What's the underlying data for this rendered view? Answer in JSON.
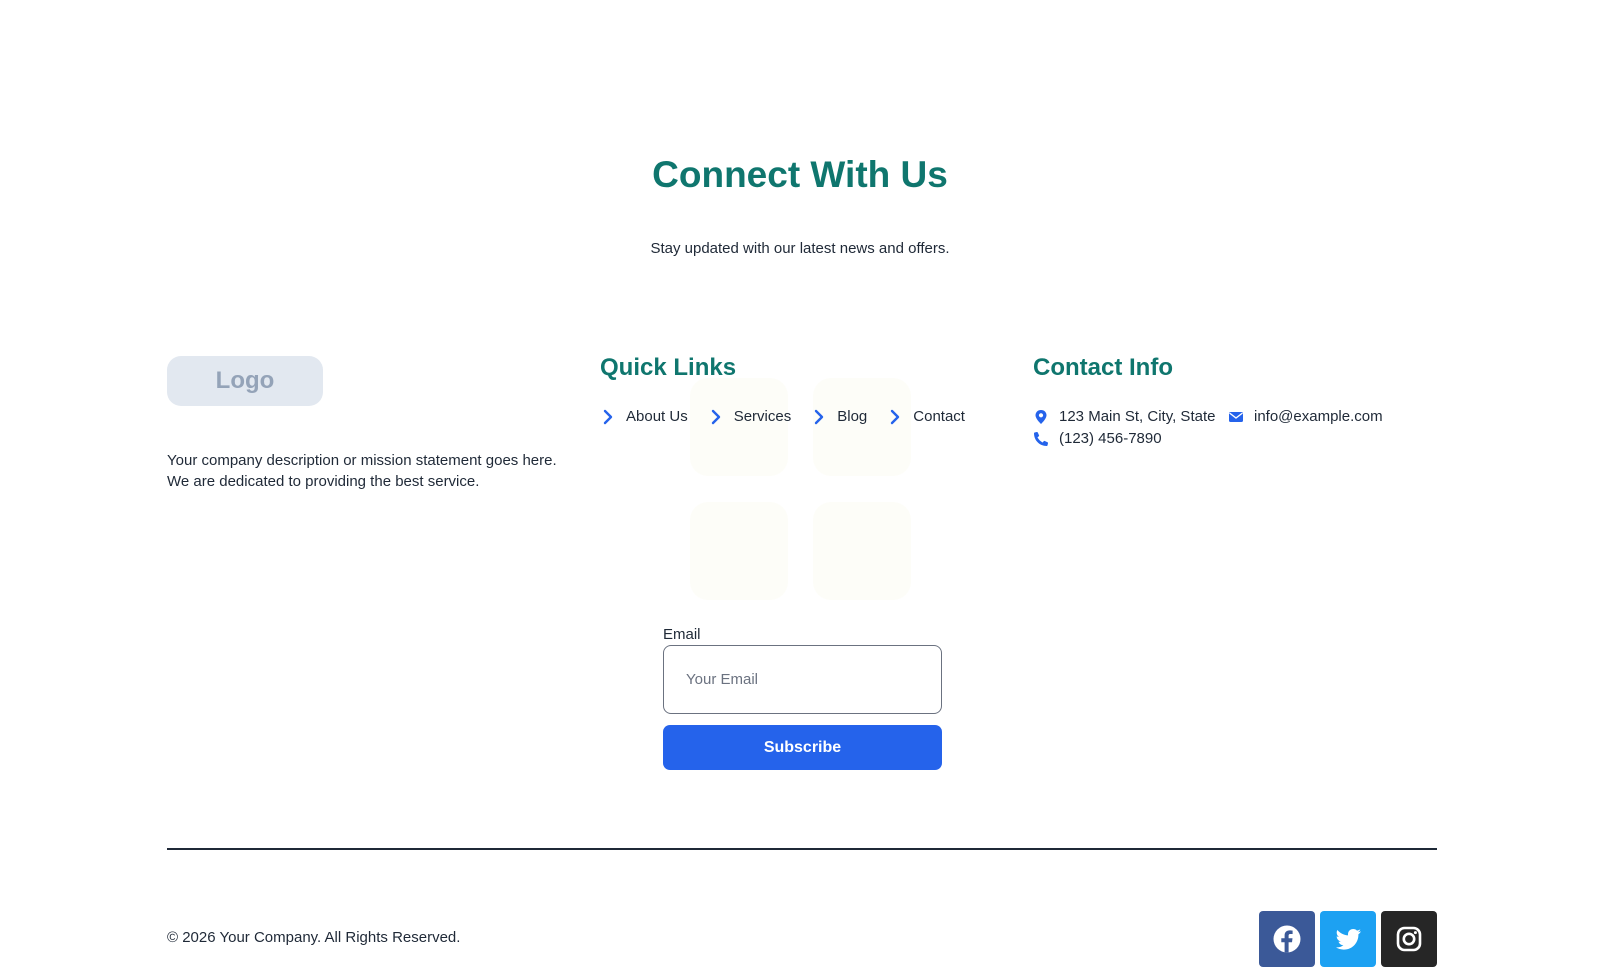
{
  "hero": {
    "title": "Connect With Us",
    "subtitle": "Stay updated with our latest news and offers."
  },
  "brand": {
    "logo_text": "Logo",
    "description": "Your company description or mission statement goes here. We are dedicated to providing the best service."
  },
  "quick_links": {
    "heading": "Quick Links",
    "items": [
      {
        "label": "About Us",
        "icon": "chevron-right-icon"
      },
      {
        "label": "Services",
        "icon": "chevron-right-icon"
      },
      {
        "label": "Blog",
        "icon": "chevron-right-icon"
      },
      {
        "label": "Contact",
        "icon": "chevron-right-icon"
      }
    ]
  },
  "contact_info": {
    "heading": "Contact Info",
    "address": "123 Main St, City, State",
    "email": "info@example.com",
    "phone": "(123) 456-7890"
  },
  "newsletter": {
    "email_label": "Email",
    "email_placeholder": "Your Email",
    "email_value": "",
    "subscribe_label": "Subscribe"
  },
  "footer": {
    "copyright": "© 2026 Your Company. All Rights Reserved.",
    "social": [
      {
        "name": "facebook-icon",
        "color": "#3b5998"
      },
      {
        "name": "twitter-icon",
        "color": "#1da1f2"
      },
      {
        "name": "instagram-icon",
        "color": "#262626"
      }
    ]
  },
  "colors": {
    "heading": "#0f766e",
    "accent": "#2563eb",
    "text": "#1f2937"
  }
}
